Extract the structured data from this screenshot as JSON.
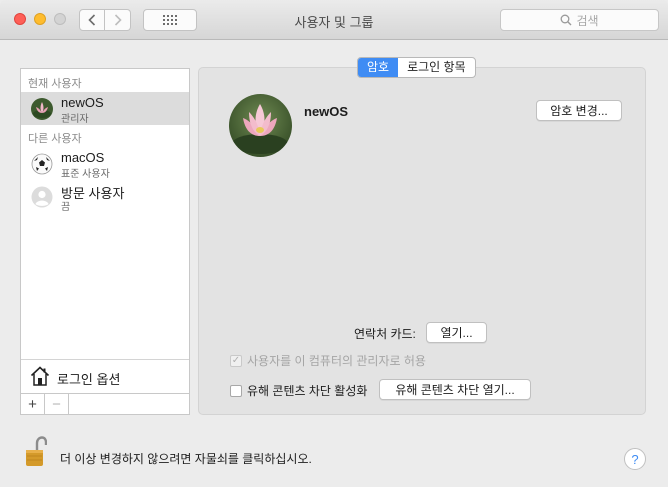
{
  "window": {
    "title": "사용자 및 그룹"
  },
  "search": {
    "placeholder": "검색"
  },
  "sidebar": {
    "current_section": "현재 사용자",
    "other_section": "다른 사용자",
    "current_user": {
      "name": "newOS",
      "role": "관리자"
    },
    "other_users": [
      {
        "name": "macOS",
        "role": "표준 사용자"
      },
      {
        "name": "방문 사용자",
        "role": "끔"
      }
    ],
    "login_options": "로그인 옵션",
    "add": "+",
    "remove": "−"
  },
  "tabs": [
    {
      "label": "암호",
      "active": true
    },
    {
      "label": "로그인 항목",
      "active": false
    }
  ],
  "main": {
    "user_name": "newOS",
    "change_password": "암호 변경...",
    "contact_card_label": "연락처 카드:",
    "open_button": "열기...",
    "allow_admin": {
      "label": "사용자를 이 컴퓨터의 관리자로 허용",
      "checked": true,
      "disabled": true
    },
    "parental": {
      "label": "유해 콘텐츠 차단 활성화",
      "checked": false
    },
    "open_parental": "유해 콘텐츠 차단 열기..."
  },
  "footer": {
    "lock_text": "더 이상 변경하지 않으려면 자물쇠를 클릭하십시오.",
    "help": "?"
  },
  "colors": {
    "accent": "#3f8cf4",
    "close": "#fe5f57",
    "minimize": "#febc2e"
  }
}
